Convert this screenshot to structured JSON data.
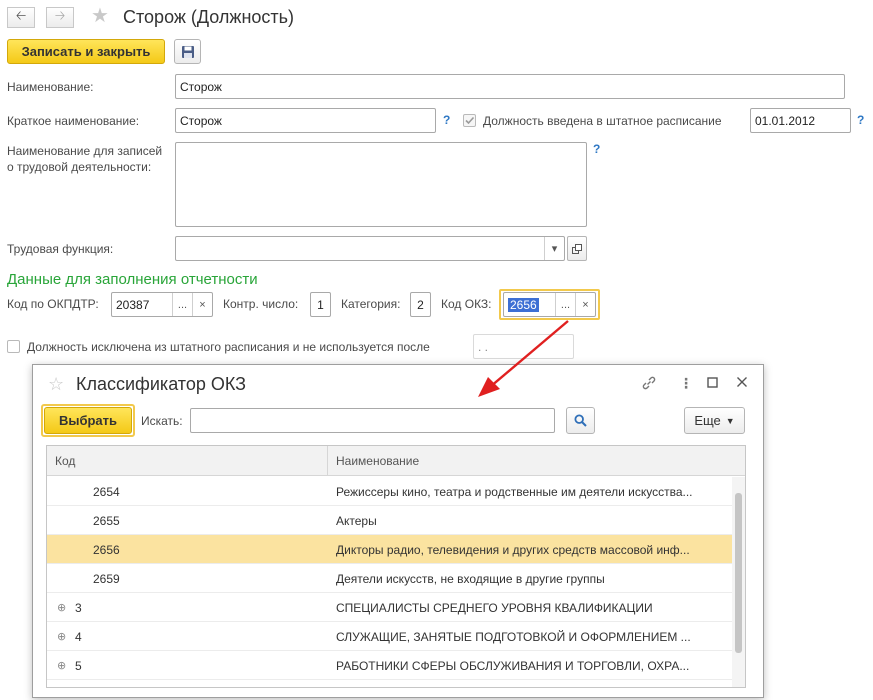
{
  "window": {
    "title": "Сторож (Должность)",
    "back_icon": "arrow-left-icon",
    "forward_icon": "arrow-right-icon",
    "favorite_icon": "star-icon"
  },
  "toolbar": {
    "save_close_label": "Записать и закрыть",
    "save_icon": "floppy-disk-icon"
  },
  "form": {
    "name_label": "Наименование:",
    "name_value": "Сторож",
    "short_name_label": "Краткое наименование:",
    "short_name_value": "Сторож",
    "help_mark": "?",
    "staffing_checkbox_label": "Должность введена в штатное расписание",
    "staffing_date": "01.01.2012",
    "work_records_label_line1": "Наименование для записей",
    "work_records_label_line2": "о трудовой деятельности:",
    "work_records_value": "",
    "labor_function_label": "Трудовая функция:",
    "labor_function_value": ""
  },
  "reporting": {
    "section_title": "Данные для заполнения отчетности",
    "okpdtr_label": "Код по ОКПДТР:",
    "okpdtr_value": "20387",
    "control_number_label": "Контр. число:",
    "control_number_value": "1",
    "category_label": "Категория:",
    "category_value": "2",
    "okz_label": "Код ОКЗ:",
    "okz_value": "2656",
    "ellipsis": "...",
    "clear": "×"
  },
  "excluded": {
    "label": "Должность исключена из штатного расписания и не используется после",
    "date_placeholder": ". ."
  },
  "dialog": {
    "title": "Классификатор ОКЗ",
    "choose_label": "Выбрать",
    "search_label": "Искать:",
    "search_value": "",
    "more_label": "Еще",
    "columns": {
      "code": "Код",
      "name": "Наименование"
    },
    "rows": [
      {
        "code": "2654",
        "name": "Режиссеры кино, театра и родственные им деятели искусства...",
        "selected": false,
        "group": false
      },
      {
        "code": "2655",
        "name": "Актеры",
        "selected": false,
        "group": false
      },
      {
        "code": "2656",
        "name": "Дикторы радио, телевидения и других средств массовой инф...",
        "selected": true,
        "group": false
      },
      {
        "code": "2659",
        "name": "Деятели искусств, не входящие в другие группы",
        "selected": false,
        "group": false
      },
      {
        "code": "3",
        "name": "СПЕЦИАЛИСТЫ СРЕДНЕГО УРОВНЯ КВАЛИФИКАЦИИ",
        "selected": false,
        "group": true
      },
      {
        "code": "4",
        "name": "СЛУЖАЩИЕ, ЗАНЯТЫЕ ПОДГОТОВКОЙ И ОФОРМЛЕНИЕМ ...",
        "selected": false,
        "group": true
      },
      {
        "code": "5",
        "name": "РАБОТНИКИ СФЕРЫ ОБСЛУЖИВАНИЯ И ТОРГОВЛИ, ОХРА...",
        "selected": false,
        "group": true
      }
    ]
  },
  "colors": {
    "accent_yellow": "#f4c917",
    "section_green": "#29a539",
    "selection": "#fbe3a0",
    "help_blue": "#2f78c4",
    "arrow_red": "#e02020"
  }
}
